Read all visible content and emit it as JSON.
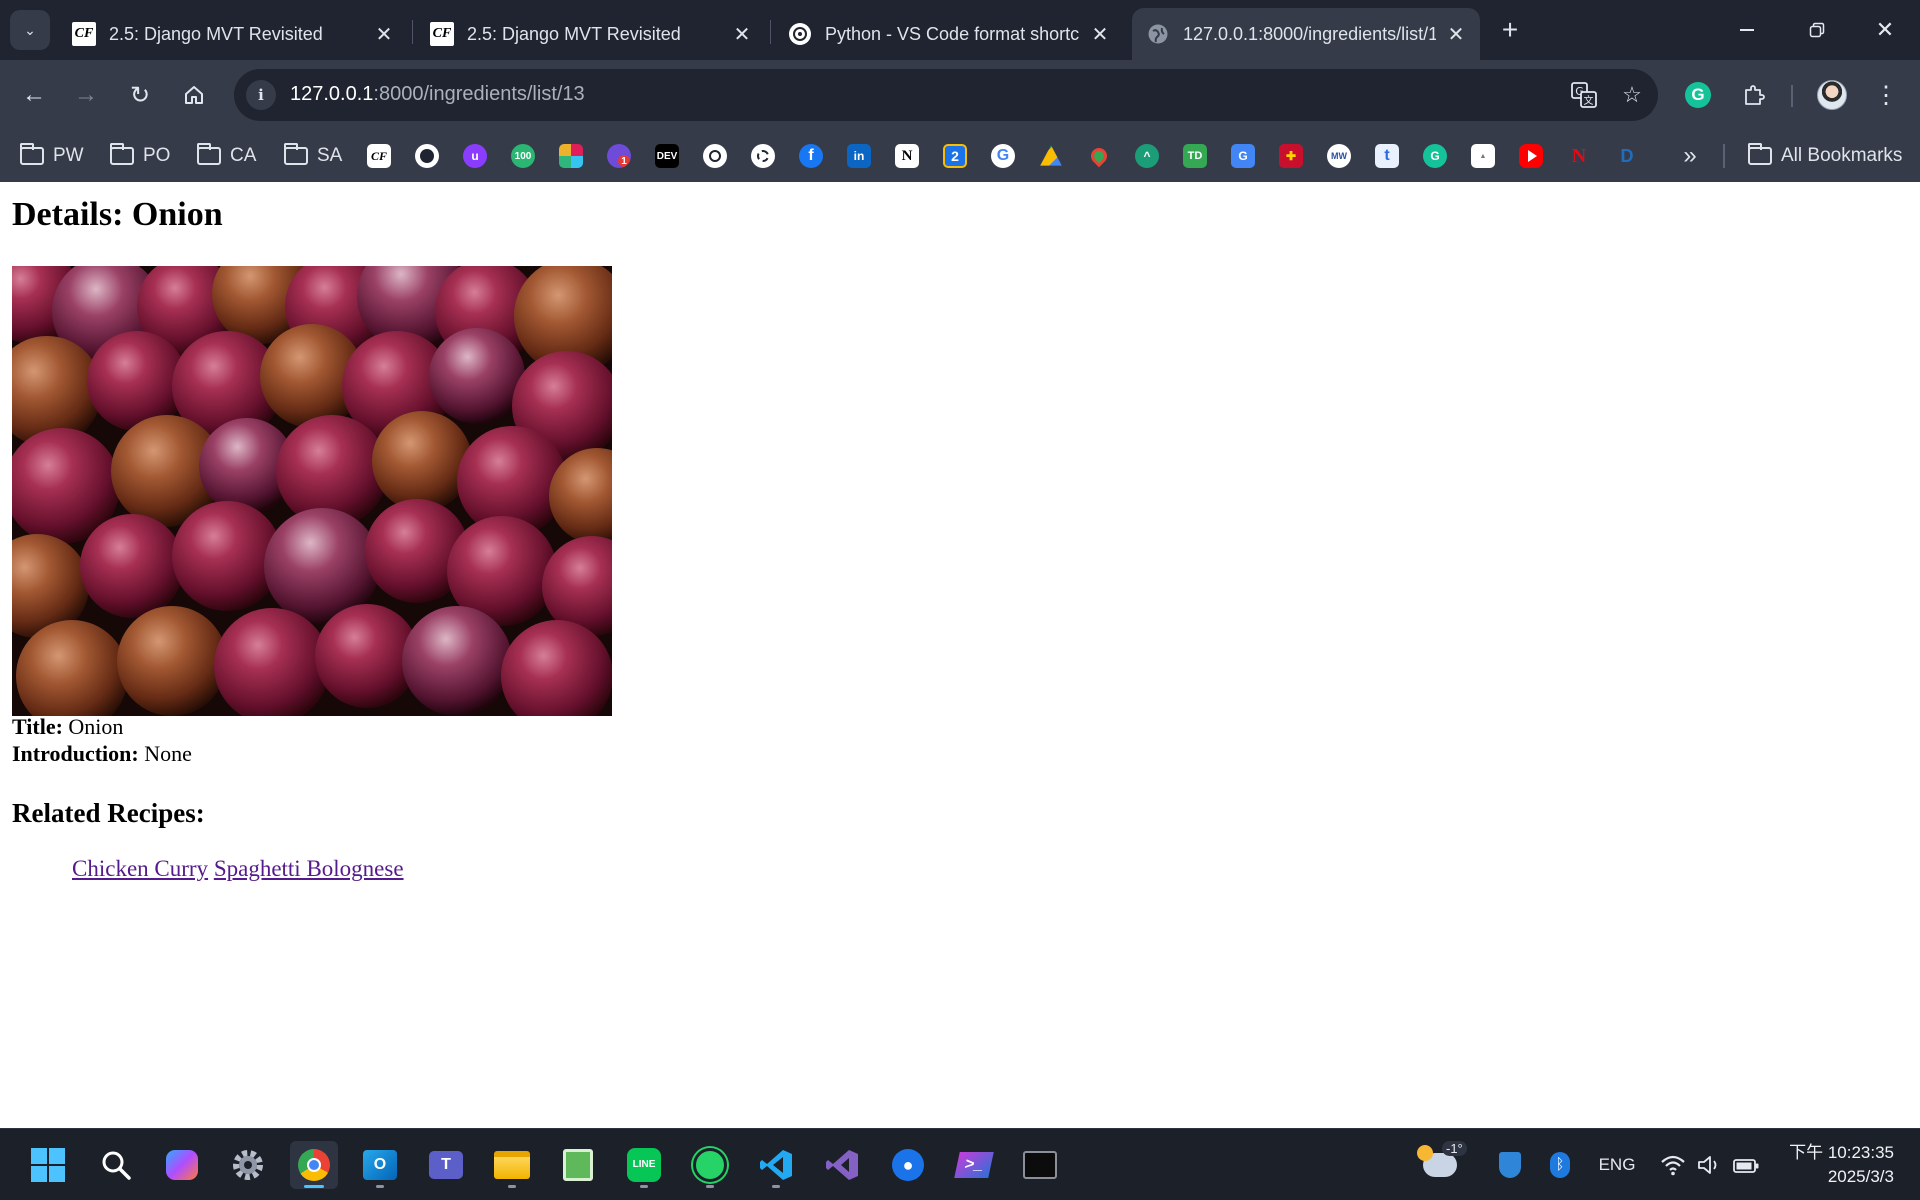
{
  "browser": {
    "tabs": [
      {
        "title": "2.5: Django MVT Revisited",
        "favicon": "cf-icon"
      },
      {
        "title": "2.5: Django MVT Revisited",
        "favicon": "cf-icon"
      },
      {
        "title": "Python - VS Code format shortc",
        "favicon": "chatgpt-icon"
      },
      {
        "title": "127.0.0.1:8000/ingredients/list/1",
        "favicon": "globe-icon"
      }
    ],
    "address": {
      "host": "127.0.0.1",
      "rest": ":8000/ingredients/list/13"
    },
    "bookmark_folders": [
      "PW",
      "PO",
      "CA",
      "SA"
    ],
    "all_bookmarks_label": "All Bookmarks",
    "bookmark_badges": {
      "hundred": "100",
      "dev": "DEV",
      "in": "in",
      "notion": "N",
      "two": "2",
      "td": "TD",
      "mw": "MW",
      "t": "t"
    }
  },
  "page": {
    "heading": "Details: Onion",
    "image_alt": "Onion",
    "title_label": "Title:",
    "title_value": " Onion",
    "intro_label": "Introduction:",
    "intro_value": " None",
    "related_heading": "Related Recipes:",
    "related_recipes": [
      "Chicken Curry",
      "Spaghetti Bolognese"
    ]
  },
  "taskbar": {
    "weather_temp": "-1°",
    "language": "ENG",
    "time": "下午 10:23:35",
    "date": "2025/3/3"
  },
  "colors": {
    "chrome_dark": "#1f2430",
    "chrome_toolbar": "#353b48",
    "link_visited": "#551a8b"
  }
}
